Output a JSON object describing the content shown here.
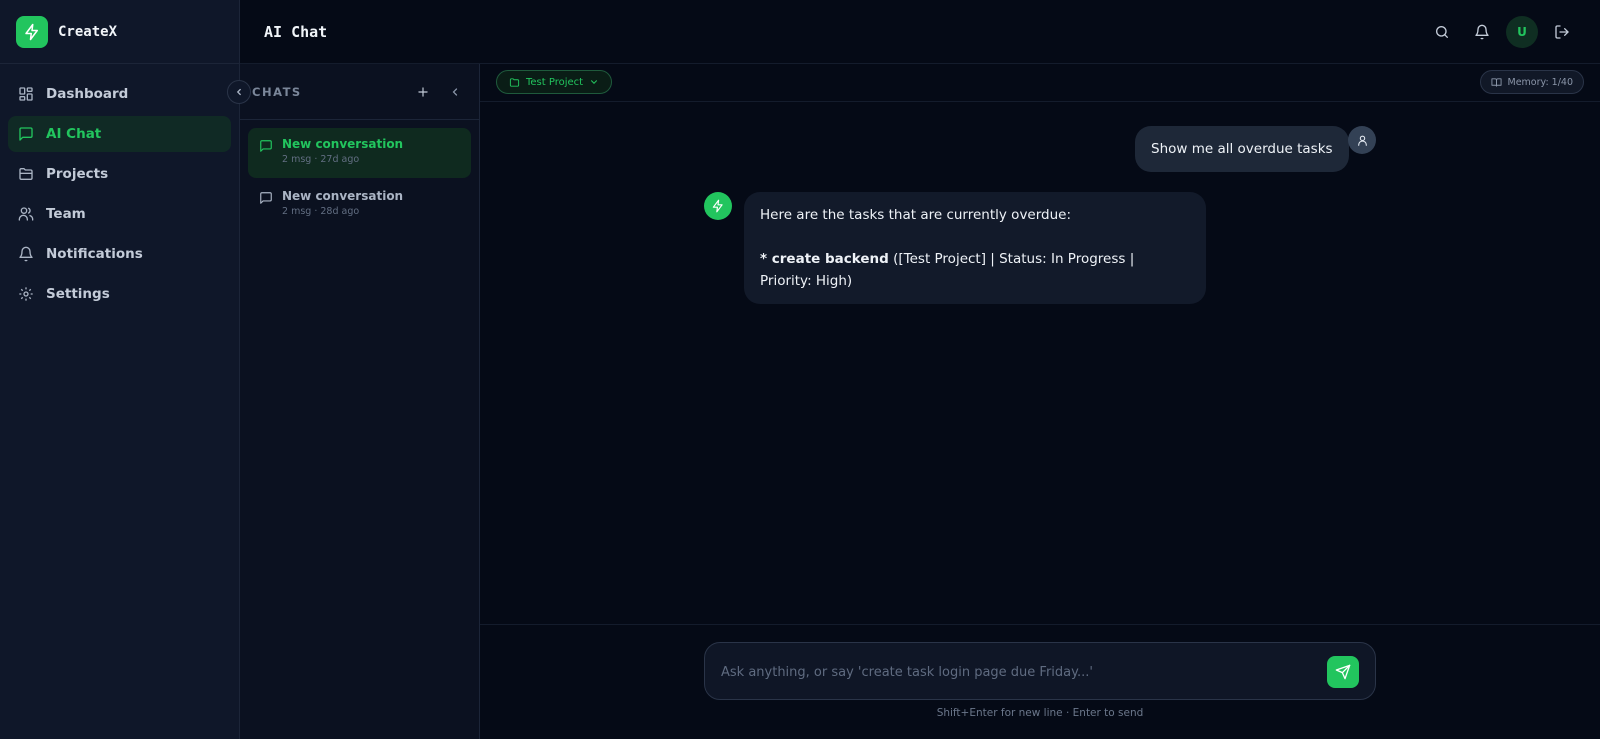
{
  "app": {
    "name": "CreateX"
  },
  "header": {
    "title": "AI Chat",
    "avatar_initial": "U"
  },
  "sidebar": {
    "items": [
      {
        "label": "Dashboard",
        "icon": "grid-icon"
      },
      {
        "label": "AI Chat",
        "icon": "message-icon",
        "active": true
      },
      {
        "label": "Projects",
        "icon": "folder-icon"
      },
      {
        "label": "Team",
        "icon": "users-icon"
      },
      {
        "label": "Notifications",
        "icon": "bell-icon"
      },
      {
        "label": "Settings",
        "icon": "gear-icon"
      }
    ]
  },
  "chats": {
    "title": "CHATS",
    "items": [
      {
        "title": "New conversation",
        "meta": "2 msg · 27d ago",
        "active": true
      },
      {
        "title": "New conversation",
        "meta": "2 msg · 28d ago",
        "active": false
      }
    ]
  },
  "context": {
    "project": "Test Project",
    "memory": "Memory: 1/40"
  },
  "messages": {
    "user": "Show me all overdue tasks",
    "ai_intro": "Here are the tasks that are currently overdue:",
    "ai_bullet": "* ",
    "ai_task": "create backend",
    "ai_details": " ([Test Project] | Status: In Progress | Priority: High)"
  },
  "composer": {
    "placeholder": "Ask anything, or say 'create task login page due Friday...'",
    "hint": "Shift+Enter for new line · Enter to send"
  },
  "colors": {
    "accent": "#22c55e",
    "background": "#050a16",
    "sidebar": "#0f1729"
  }
}
